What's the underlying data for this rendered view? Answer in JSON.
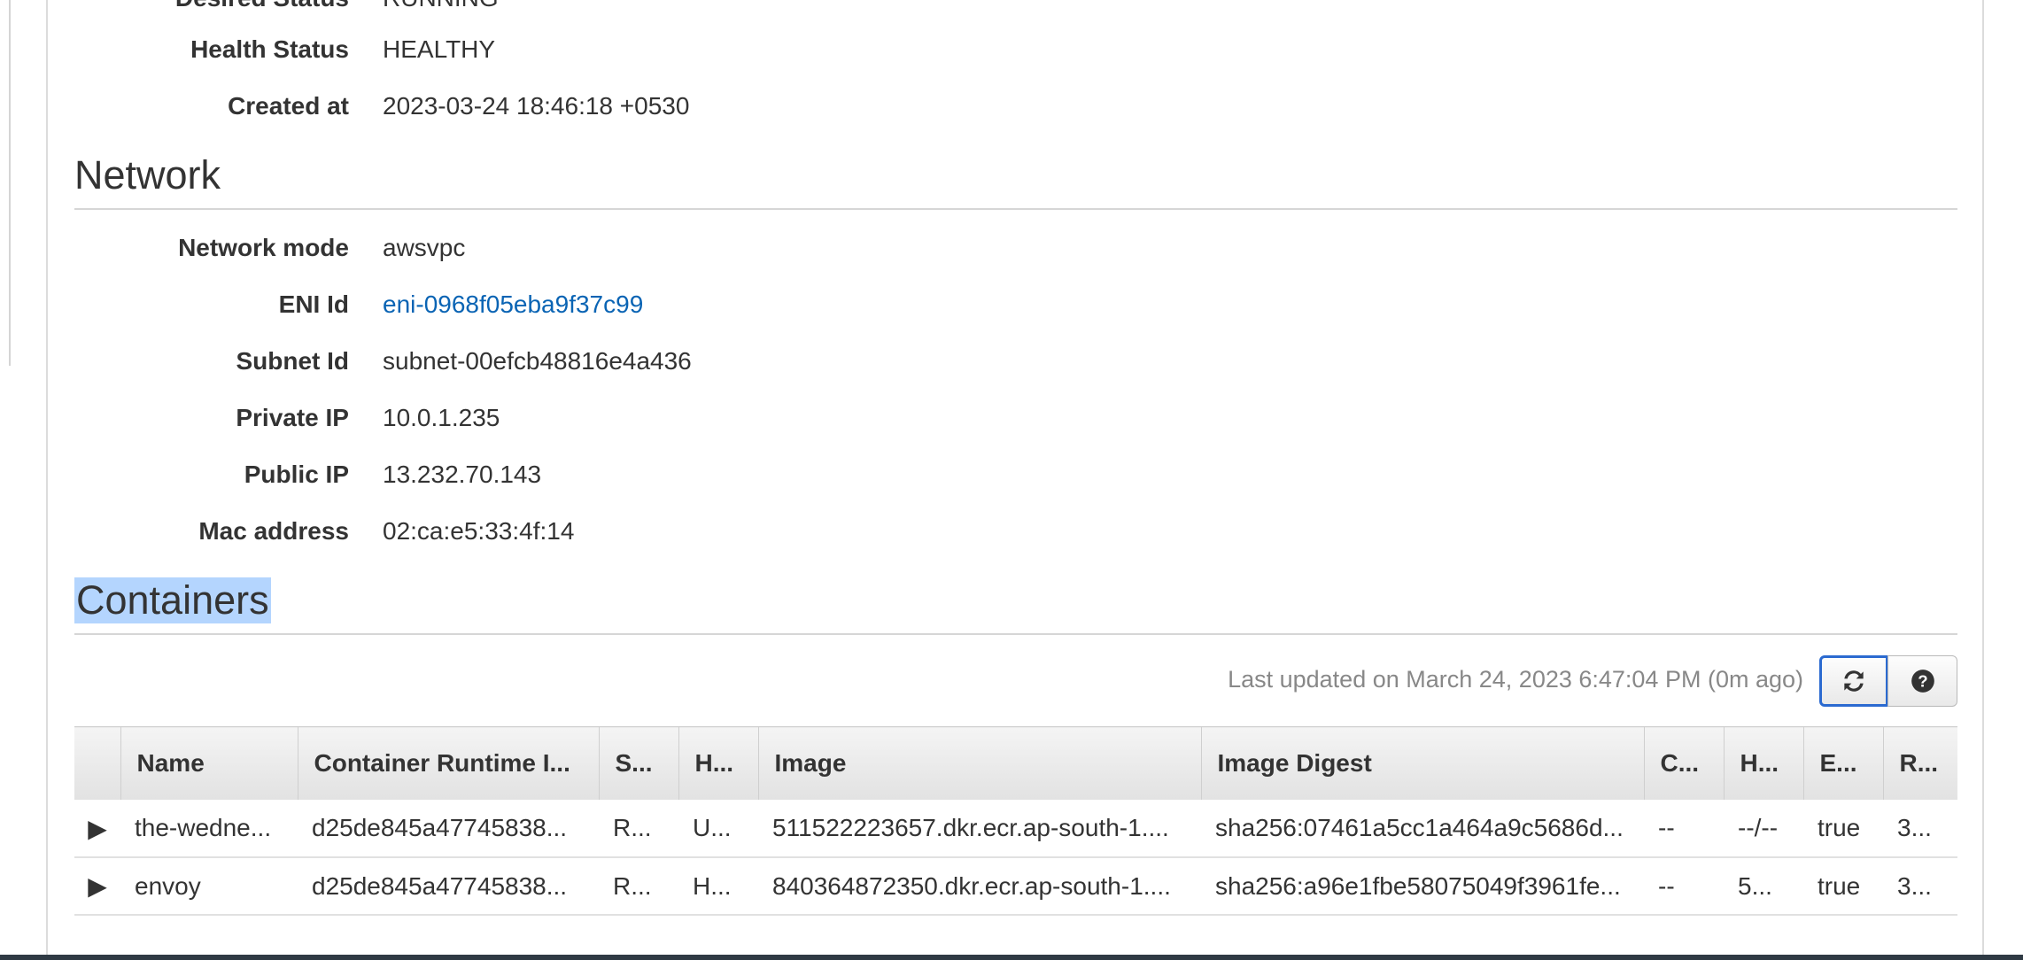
{
  "details": {
    "desired_status": {
      "label": "Desired Status",
      "value": "RUNNING"
    },
    "health_status": {
      "label": "Health Status",
      "value": "HEALTHY"
    },
    "created_at": {
      "label": "Created at",
      "value": "2023-03-24 18:46:18 +0530"
    }
  },
  "network": {
    "title": "Network",
    "network_mode": {
      "label": "Network mode",
      "value": "awsvpc"
    },
    "eni_id": {
      "label": "ENI Id",
      "value": "eni-0968f05eba9f37c99"
    },
    "subnet_id": {
      "label": "Subnet Id",
      "value": "subnet-00efcb48816e4a436"
    },
    "private_ip": {
      "label": "Private IP",
      "value": "10.0.1.235"
    },
    "public_ip": {
      "label": "Public IP",
      "value": "13.232.70.143"
    },
    "mac_address": {
      "label": "Mac address",
      "value": "02:ca:e5:33:4f:14"
    }
  },
  "containers": {
    "title": "Containers",
    "last_updated": "Last updated on March 24, 2023 6:47:04 PM (0m ago)",
    "refresh_icon": "refresh-icon",
    "help_icon": "help-icon",
    "columns": [
      "Name",
      "Container Runtime I...",
      "S...",
      "H...",
      "Image",
      "Image Digest",
      "C...",
      "H...",
      "E...",
      "R..."
    ],
    "rows": [
      {
        "name": "the-wedne...",
        "runtime_id": "d25de845a47745838...",
        "status": "R...",
        "health": "U...",
        "image": "511522223657.dkr.ecr.ap-south-1....",
        "digest": "sha256:07461a5cc1a464a9c5686d...",
        "c": "--",
        "h": "--/--",
        "e": "true",
        "r": "3..."
      },
      {
        "name": "envoy",
        "runtime_id": "d25de845a47745838...",
        "status": "R...",
        "health": "H...",
        "image": "840364872350.dkr.ecr.ap-south-1....",
        "digest": "sha256:a96e1fbe58075049f3961fe...",
        "c": "--",
        "h": "5...",
        "e": "true",
        "r": "3..."
      }
    ],
    "colors": {
      "status_running": "#1d8102",
      "link": "#0a64b4",
      "selection": "#b4d5fe"
    }
  }
}
